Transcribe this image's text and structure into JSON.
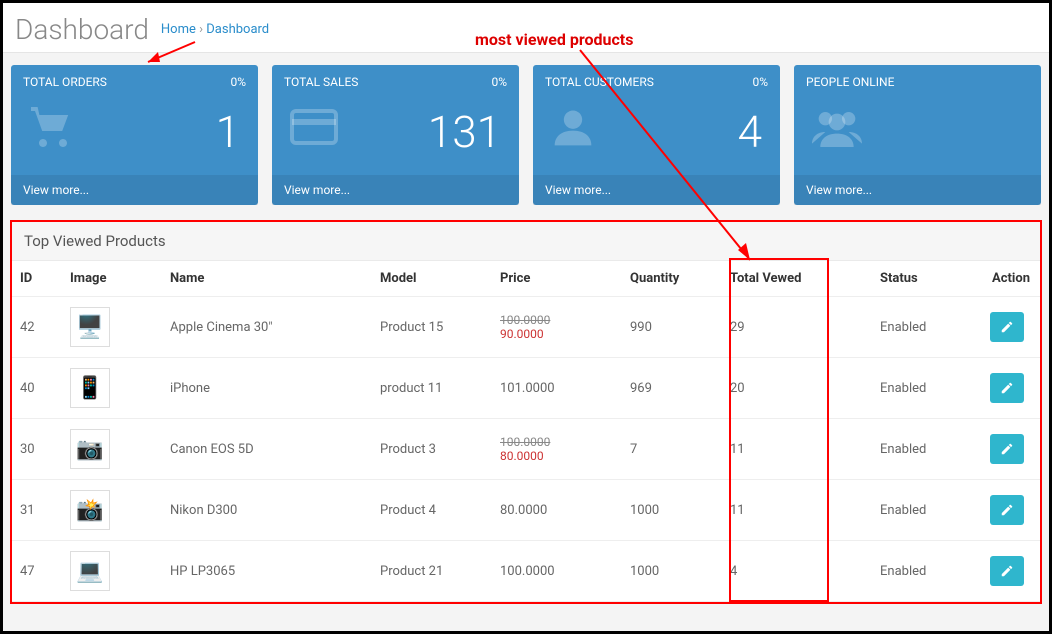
{
  "header": {
    "title": "Dashboard",
    "breadcrumb_home": "Home",
    "breadcrumb_sep": "›",
    "breadcrumb_current": "Dashboard"
  },
  "annotation": {
    "text": "most viewed products"
  },
  "cards": [
    {
      "label": "TOTAL ORDERS",
      "pct": "0%",
      "value": "1",
      "icon": "cart-icon",
      "footer": "View more..."
    },
    {
      "label": "TOTAL SALES",
      "pct": "0%",
      "value": "131",
      "icon": "card-icon",
      "footer": "View more..."
    },
    {
      "label": "TOTAL CUSTOMERS",
      "pct": "0%",
      "value": "4",
      "icon": "user-icon",
      "footer": "View more..."
    },
    {
      "label": "PEOPLE ONLINE",
      "pct": "",
      "value": "",
      "icon": "users-icon",
      "footer": "View more..."
    }
  ],
  "panel": {
    "title": "Top Viewed Products",
    "columns": [
      "ID",
      "Image",
      "Name",
      "Model",
      "Price",
      "Quantity",
      "Total Vewed",
      "Status",
      "Action"
    ],
    "rows": [
      {
        "id": "42",
        "image": "🖥️",
        "name": "Apple Cinema 30\"",
        "model": "Product 15",
        "price_old": "100.0000",
        "price_new": "90.0000",
        "qty": "990",
        "viewed": "29",
        "status": "Enabled"
      },
      {
        "id": "40",
        "image": "📱",
        "name": "iPhone",
        "model": "product 11",
        "price_old": "",
        "price_new": "101.0000",
        "qty": "969",
        "viewed": "20",
        "status": "Enabled"
      },
      {
        "id": "30",
        "image": "📷",
        "name": "Canon EOS 5D",
        "model": "Product 3",
        "price_old": "100.0000",
        "price_new": "80.0000",
        "qty": "7",
        "viewed": "11",
        "status": "Enabled"
      },
      {
        "id": "31",
        "image": "📸",
        "name": "Nikon D300",
        "model": "Product 4",
        "price_old": "",
        "price_new": "80.0000",
        "qty": "1000",
        "viewed": "11",
        "status": "Enabled"
      },
      {
        "id": "47",
        "image": "💻",
        "name": "HP LP3065",
        "model": "Product 21",
        "price_old": "",
        "price_new": "100.0000",
        "qty": "1000",
        "viewed": "4",
        "status": "Enabled"
      }
    ]
  }
}
